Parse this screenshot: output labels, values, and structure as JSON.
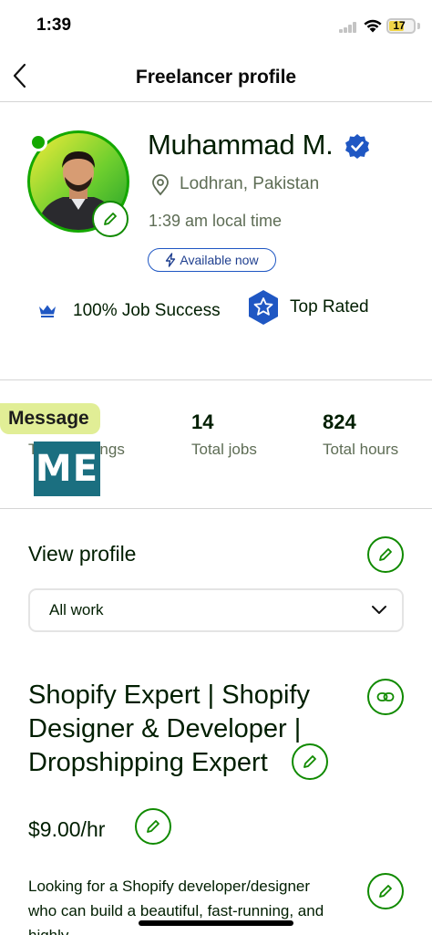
{
  "status_bar": {
    "time": "1:39",
    "battery": "17"
  },
  "nav": {
    "title": "Freelancer profile"
  },
  "profile": {
    "name": "Muhammad M.",
    "location": "Lodhran, Pakistan",
    "local_time": "1:39 am local time",
    "availability": "Available now",
    "job_success": "100% Job Success",
    "top_rated": "Top Rated"
  },
  "stats": {
    "earnings_label": "Total earnings",
    "jobs_value": "14",
    "jobs_label": "Total jobs",
    "hours_value": "824",
    "hours_label": "Total hours"
  },
  "overlay": {
    "message_label": "Message",
    "logo_text": "ME"
  },
  "view_profile": {
    "title": "View profile",
    "select_value": "All work"
  },
  "work": {
    "title": "Shopify Expert | Shopify Designer & Developer | Dropshipping Expert",
    "rate": "$9.00/hr",
    "overview": "Looking for a Shopify developer/designer who can build a beautiful, fast-running, and highly"
  },
  "colors": {
    "brand_green": "#14a800",
    "verified_blue": "#1f57c3",
    "message_bg": "#e1ee96",
    "logo_bg": "#1b6f80"
  }
}
